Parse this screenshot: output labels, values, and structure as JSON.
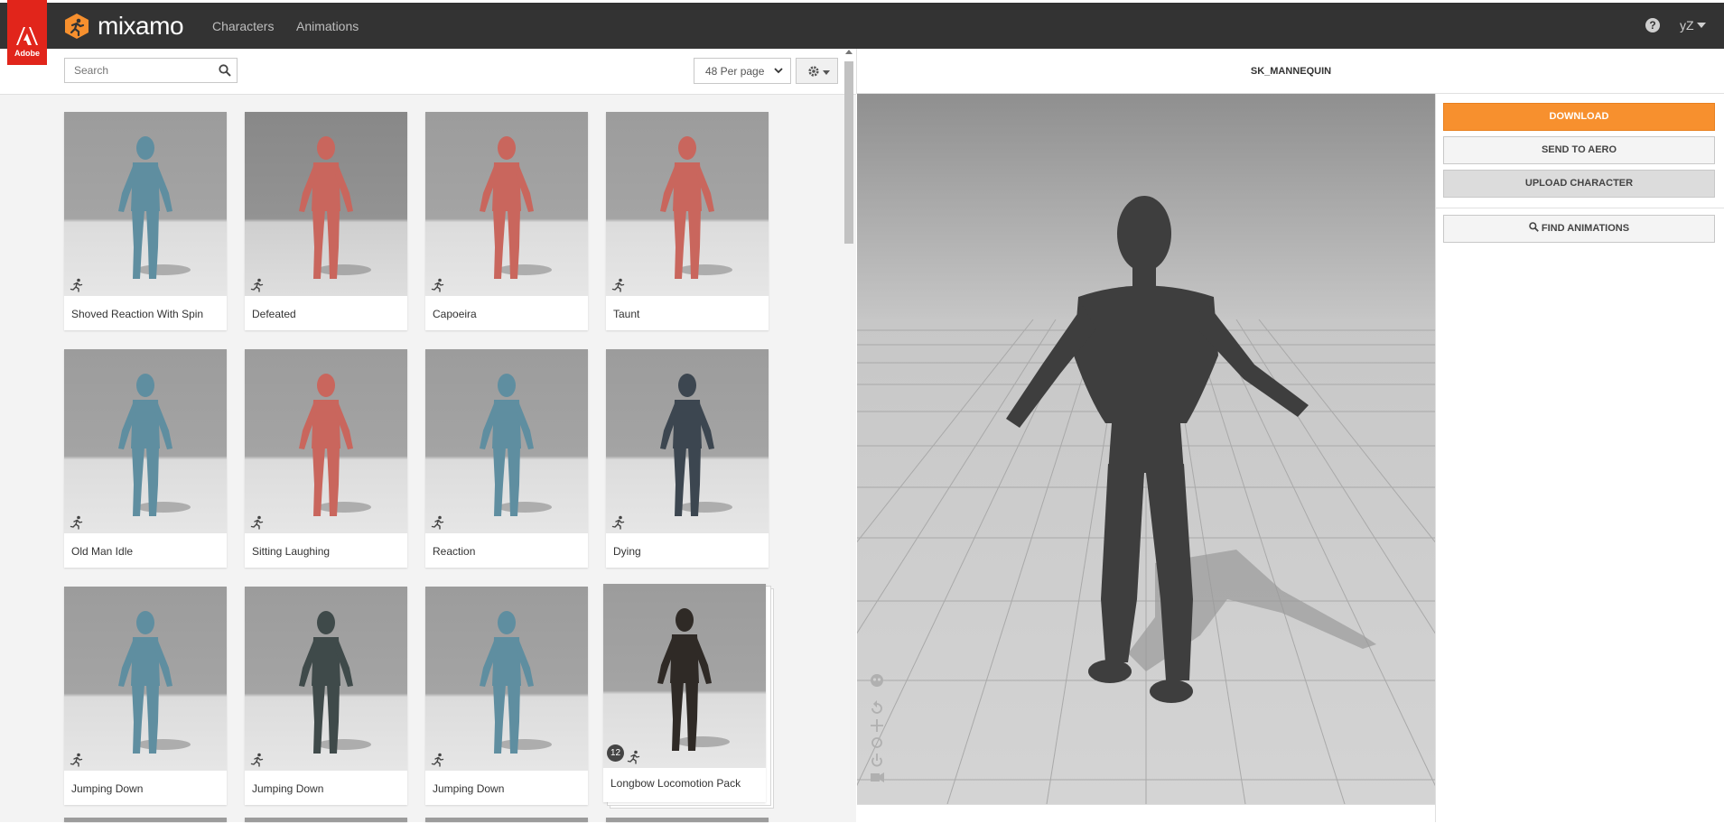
{
  "header": {
    "adobe_label": "Adobe",
    "brand": "mixamo",
    "nav": [
      {
        "label": "Characters"
      },
      {
        "label": "Animations"
      }
    ],
    "help": "?",
    "user": "yZ"
  },
  "toolbar": {
    "search_placeholder": "Search",
    "per_page": "48 Per page"
  },
  "animations": [
    {
      "label": "Shoved Reaction With Spin",
      "color": "#5f8ea0"
    },
    {
      "label": "Defeated",
      "color": "#c9665d",
      "selected": true
    },
    {
      "label": "Capoeira",
      "color": "#c9665d"
    },
    {
      "label": "Taunt",
      "color": "#c9665d"
    },
    {
      "label": "Old Man Idle",
      "color": "#5f8ea0"
    },
    {
      "label": "Sitting Laughing",
      "color": "#c9665d"
    },
    {
      "label": "Reaction",
      "color": "#5f8ea0"
    },
    {
      "label": "Dying",
      "color": "#3c4650"
    },
    {
      "label": "Jumping Down",
      "color": "#5f8ea0"
    },
    {
      "label": "Jumping Down",
      "color": "#3f4a4a"
    },
    {
      "label": "Jumping Down",
      "color": "#5f8ea0"
    },
    {
      "label": "Longbow Locomotion Pack",
      "color": "#2f2a26",
      "pack_count": "12"
    }
  ],
  "viewer": {
    "title": "SK_MANNEQUIN"
  },
  "actions": {
    "download": "DOWNLOAD",
    "send_to_aero": "SEND TO AERO",
    "upload_character": "UPLOAD CHARACTER",
    "find_animations": "FIND ANIMATIONS"
  }
}
